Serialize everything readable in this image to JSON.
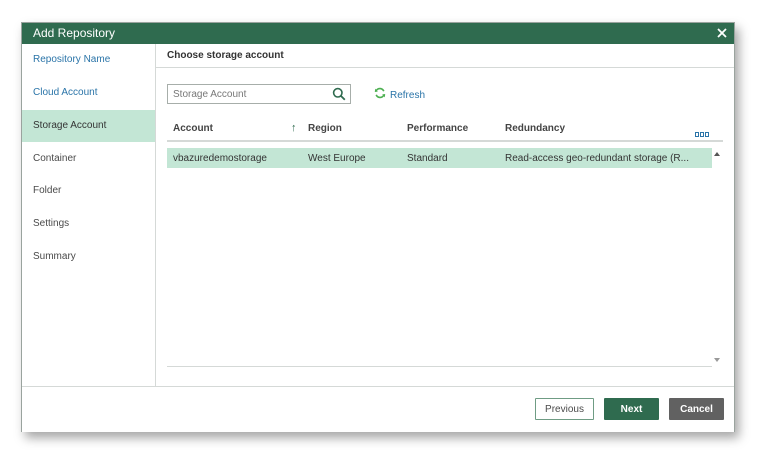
{
  "window": {
    "title": "Add Repository",
    "close_icon": "close-icon"
  },
  "colors": {
    "titlebar": "#2f6b4f",
    "selection": "#c3e6d5",
    "link": "#2a74a8",
    "cancel": "#616161"
  },
  "sidebar": {
    "items": [
      {
        "label": "Repository Name",
        "state": "done"
      },
      {
        "label": "Cloud Account",
        "state": "done"
      },
      {
        "label": "Storage Account",
        "state": "active"
      },
      {
        "label": "Container",
        "state": "pending"
      },
      {
        "label": "Folder",
        "state": "pending"
      },
      {
        "label": "Settings",
        "state": "pending"
      },
      {
        "label": "Summary",
        "state": "pending"
      }
    ]
  },
  "main": {
    "heading": "Choose storage account",
    "search": {
      "placeholder": "Storage Account",
      "value": "",
      "icon": "search-icon"
    },
    "refresh": {
      "label": "Refresh",
      "icon": "refresh-icon"
    },
    "table": {
      "columns": [
        "Account",
        "Region",
        "Performance",
        "Redundancy"
      ],
      "sort_column": "Account",
      "sort_direction": "ascending",
      "column_chooser_icon": "column-chooser-icon",
      "rows": [
        {
          "account": "vbazuredemostorage",
          "region": "West Europe",
          "performance": "Standard",
          "redundancy": "Read-access geo-redundant storage (R...",
          "selected": true
        }
      ]
    }
  },
  "footer": {
    "previous_label": "Previous",
    "next_label": "Next",
    "cancel_label": "Cancel"
  }
}
